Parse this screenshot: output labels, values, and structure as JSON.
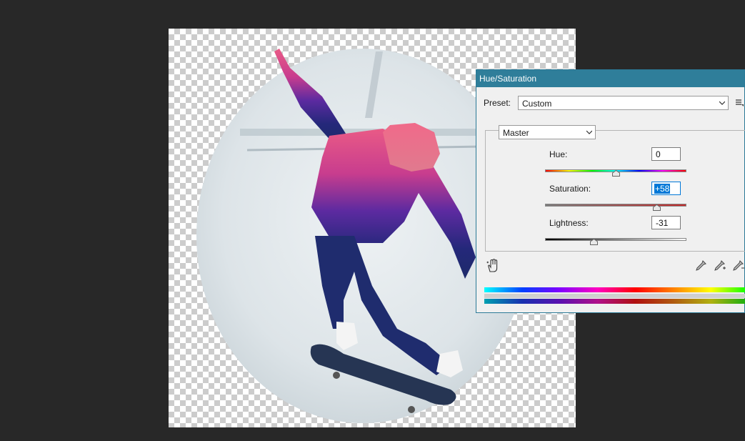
{
  "dialog": {
    "title": "Hue/Saturation",
    "preset_label": "Preset:",
    "preset_value": "Custom",
    "channel_value": "Master",
    "hue_label": "Hue:",
    "hue_value": "0",
    "saturation_label": "Saturation:",
    "saturation_value": "+58",
    "lightness_label": "Lightness:",
    "lightness_value": "-31",
    "accent": "#2f7e9a",
    "selection_color": "#0078d7"
  },
  "icons": {
    "preset_options": "list-options-icon",
    "targeted_adjustment": "hand-adjust-icon",
    "eyedropper": "eyedropper-icon",
    "eyedropper_add": "eyedropper-plus-icon",
    "eyedropper_subtract": "eyedropper-minus-icon"
  },
  "sliders": {
    "hue_level": 0,
    "saturation_level": 58,
    "lightness_level": -31
  }
}
